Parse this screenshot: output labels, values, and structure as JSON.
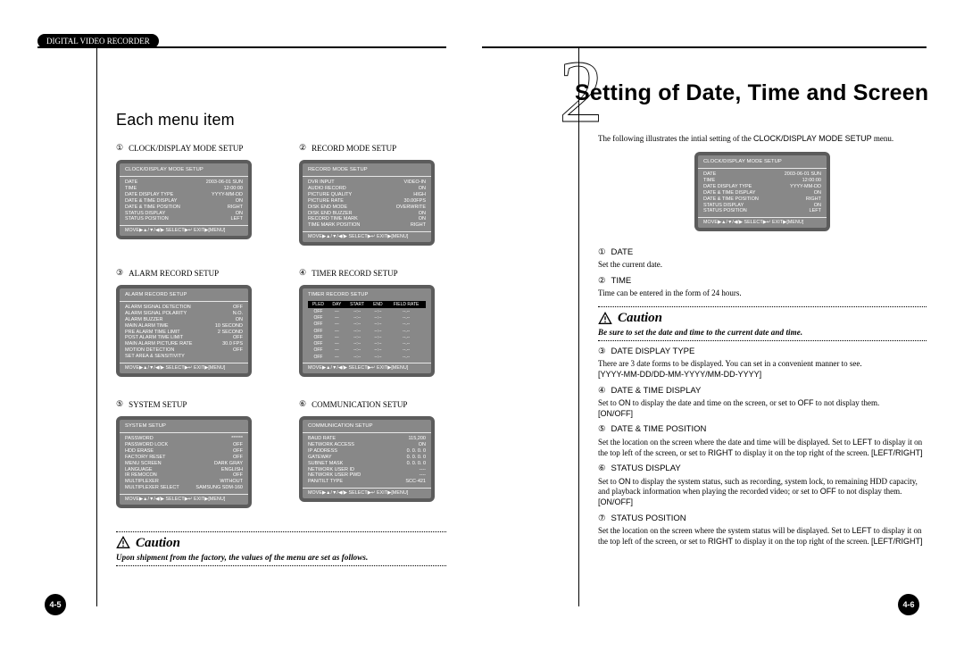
{
  "header_tab": "DIGITAL VIDEO RECORDER",
  "left": {
    "section_title": "Each menu item",
    "menu": [
      {
        "num": "①",
        "title": "CLOCK/DISPLAY MODE SETUP",
        "osd": {
          "title": "CLOCK/DISPLAY MODE SETUP",
          "rows": [
            [
              "DATE",
              "2003-06-01 SUN"
            ],
            [
              "TIME",
              "12:00:00"
            ],
            [
              "DATE DISPLAY TYPE",
              "YYYY-MM-DD"
            ],
            [
              "DATE & TIME DISPLAY",
              "ON"
            ],
            [
              "DATE & TIME POSITION",
              "RIGHT"
            ],
            [
              "STATUS DISPLAY",
              "ON"
            ],
            [
              "STATUS POSITION",
              "LEFT"
            ]
          ],
          "footer": "MOVE▶▲/▼/◀/▶  SELECT▶↵  EXIT▶[MENU]"
        }
      },
      {
        "num": "②",
        "title": "RECORD MODE SETUP",
        "osd": {
          "title": "RECORD MODE SETUP",
          "rows": [
            [
              "DVR INPUT",
              "VIDEO-IN"
            ],
            [
              "AUDIO RECORD",
              "ON"
            ],
            [
              "PICTURE QUALITY",
              "HIGH"
            ],
            [
              "PICTURE RATE",
              "30.00FPS"
            ],
            [
              "DISK END MODE",
              "OVERWRITE"
            ],
            [
              "DISK END BUZZER",
              "ON"
            ],
            [
              "RECORD TIME MARK",
              "ON"
            ],
            [
              "TIME MARK POSITION",
              "RIGHT"
            ]
          ],
          "footer": "MOVE▶▲/▼/◀/▶  SELECT▶↵  EXIT▶[MENU]"
        }
      },
      {
        "num": "③",
        "title": "ALARM RECORD SETUP",
        "osd": {
          "title": "ALARM RECORD SETUP",
          "rows": [
            [
              "ALARM SIGNAL DETECTION",
              "OFF"
            ],
            [
              "ALARM SIGNAL POLARITY",
              "N.O."
            ],
            [
              "ALARM BUZZER",
              "ON"
            ],
            [
              "MAIN ALARM TIME",
              "10 SECOND"
            ],
            [
              "PRE ALARM TIME LIMIT",
              "2 SECOND"
            ],
            [
              "POST ALARM TIME LIMIT",
              "OFF"
            ],
            [
              "MAIN ALARM PICTURE RATE",
              "30.0 FPS"
            ],
            [
              "MOTION DETECTION",
              "OFF"
            ],
            [
              "SET AREA & SENSITIVITY",
              ""
            ]
          ],
          "footer": "MOVE▶▲/▼/◀/▶  SELECT▶↵  EXIT▶[MENU]"
        }
      },
      {
        "num": "④",
        "title": "TIMER RECORD SETUP",
        "osd_timer": {
          "title": "TIMER RECORD SETUP",
          "headers": [
            "PLED",
            "DAY",
            "START",
            "END",
            "FIELD RATE"
          ],
          "rows": [
            [
              "OFF",
              "---",
              "--:--",
              "--:--",
              "--.--"
            ],
            [
              "OFF",
              "---",
              "--:--",
              "--:--",
              "--.--"
            ],
            [
              "OFF",
              "---",
              "--:--",
              "--:--",
              "--.--"
            ],
            [
              "OFF",
              "---",
              "--:--",
              "--:--",
              "--.--"
            ],
            [
              "OFF",
              "---",
              "--:--",
              "--:--",
              "--.--"
            ],
            [
              "OFF",
              "---",
              "--:--",
              "--:--",
              "--.--"
            ],
            [
              "OFF",
              "---",
              "--:--",
              "--:--",
              "--.--"
            ],
            [
              "OFF",
              "---",
              "--:--",
              "--:--",
              "--.--"
            ]
          ],
          "footer": "MOVE▶▲/▼/◀/▶  SELECT▶↵  EXIT▶[MENU]"
        }
      },
      {
        "num": "⑤",
        "title": "SYSTEM SETUP",
        "osd": {
          "title": "SYSTEM SETUP",
          "rows": [
            [
              "PASSWORD",
              "******"
            ],
            [
              "PASSWORD LOCK",
              "OFF"
            ],
            [
              "HDD ERASE",
              "OFF"
            ],
            [
              "FACTORY RESET",
              "OFF"
            ],
            [
              "MENU SCREEN",
              "DARK GRAY"
            ],
            [
              "LANGUAGE",
              "ENGLISH"
            ],
            [
              "IR REMOCON",
              "OFF"
            ],
            [
              "MULTIPLEXER",
              "WITHOUT"
            ],
            [
              "MULTIPLEXER SELECT",
              "SAMSUNG SDM-160"
            ]
          ],
          "footer": "MOVE▶▲/▼/◀/▶  SELECT▶↵  EXIT▶[MENU]"
        }
      },
      {
        "num": "⑥",
        "title": "COMMUNICATION SETUP",
        "osd": {
          "title": "COMMUNICATION SETUP",
          "rows": [
            [
              "BAUD RATE",
              "115,200"
            ],
            [
              "NETWORK ACCESS",
              "ON"
            ],
            [
              "IP ADDRESS",
              "0. 0. 0. 0"
            ],
            [
              "GATEWAY",
              "0. 0. 0. 0"
            ],
            [
              "SUBNET MASK",
              "0. 0. 0. 0"
            ],
            [
              "NETWORK USER ID",
              "----"
            ],
            [
              "NETWORK USER PWD",
              "----"
            ],
            [
              "PAN/TILT TYPE",
              "SCC-421"
            ]
          ],
          "footer": "MOVE▶▲/▼/◀/▶  SELECT▶↵  EXIT▶[MENU]"
        }
      }
    ],
    "caution_head": "Caution",
    "caution_text": "Upon shipment from the factory, the values of the menu are set as follows.",
    "page_num": "4-5"
  },
  "right": {
    "chapter_digit": "2",
    "chapter_title": "Setting of Date, Time and Screen",
    "intro_prefix": "The following illustrates the intial setting of the ",
    "intro_strong": "CLOCK/DISPLAY MODE SETUP",
    "intro_suffix": "  menu.",
    "osd": {
      "title": "CLOCK/DISPLAY MODE SETUP",
      "rows": [
        [
          "DATE",
          "2003-06-01 SUN"
        ],
        [
          "TIME",
          "12:00:00"
        ],
        [
          "DATE DISPLAY TYPE",
          "YYYY-MM-DD"
        ],
        [
          "DATE & TIME DISPLAY",
          "ON"
        ],
        [
          "DATE & TIME POSITION",
          "RIGHT"
        ],
        [
          "STATUS DISPLAY",
          "ON"
        ],
        [
          "STATUS POSITION",
          "LEFT"
        ]
      ],
      "footer": "MOVE▶▲/▼/◀/▶  SELECT▶↵  EXIT▶[MENU]"
    },
    "items": [
      {
        "num": "①",
        "title": "DATE",
        "body": "Set the current date.",
        "opt": ""
      },
      {
        "num": "②",
        "title": "TIME",
        "body": "Time can be entered in the form of 24 hours.",
        "opt": ""
      }
    ],
    "caution_head": "Caution",
    "caution_text": "Be sure to set the date and time to the current date and time.",
    "items2": [
      {
        "num": "③",
        "title": "DATE DISPLAY TYPE",
        "body": "There are 3 date forms to be displayed. You can set in a convenient manner to see.",
        "opt": "[YYYY-MM-DD/DD-MM-YYYY/MM-DD-YYYY]"
      },
      {
        "num": "④",
        "title": "DATE & TIME DISPLAY",
        "body_html": "Set to <span class='sans'>ON</span> to display the date and time on the screen, or set to <span class='sans'>OFF</span> to not display them.",
        "opt": "[ON/OFF]"
      },
      {
        "num": "⑤",
        "title": "DATE & TIME POSITION",
        "body_html": "Set the location on the screen where the date and time will be displayed. Set to <span class='sans'>LEFT</span> to display it on the top left of the screen, or set to <span class='sans'>RIGHT</span> to display it on the top right of the screen. <span class='sans'>[LEFT/RIGHT]</span>",
        "opt": ""
      },
      {
        "num": "⑥",
        "title": "STATUS DISPLAY",
        "body_html": "Set to <span class='sans'>ON</span> to display the system status, such as recording, system lock, to remaining HDD capacity, and playback information when playing the recorded video; or set to <span class='sans'>OFF</span> to not display them. <span class='sans'>[ON/OFF]</span>",
        "opt": ""
      },
      {
        "num": "⑦",
        "title": "STATUS POSITION",
        "body_html": "Set the location on the screen where the system status will be displayed. Set to <span class='sans'>LEFT</span> to display it on the top left of the screen, or set to <span class='sans'>RIGHT</span> to display it on the top right of the screen. <span class='sans'>[LEFT/RIGHT]</span>",
        "opt": ""
      }
    ],
    "page_num": "4-6"
  }
}
